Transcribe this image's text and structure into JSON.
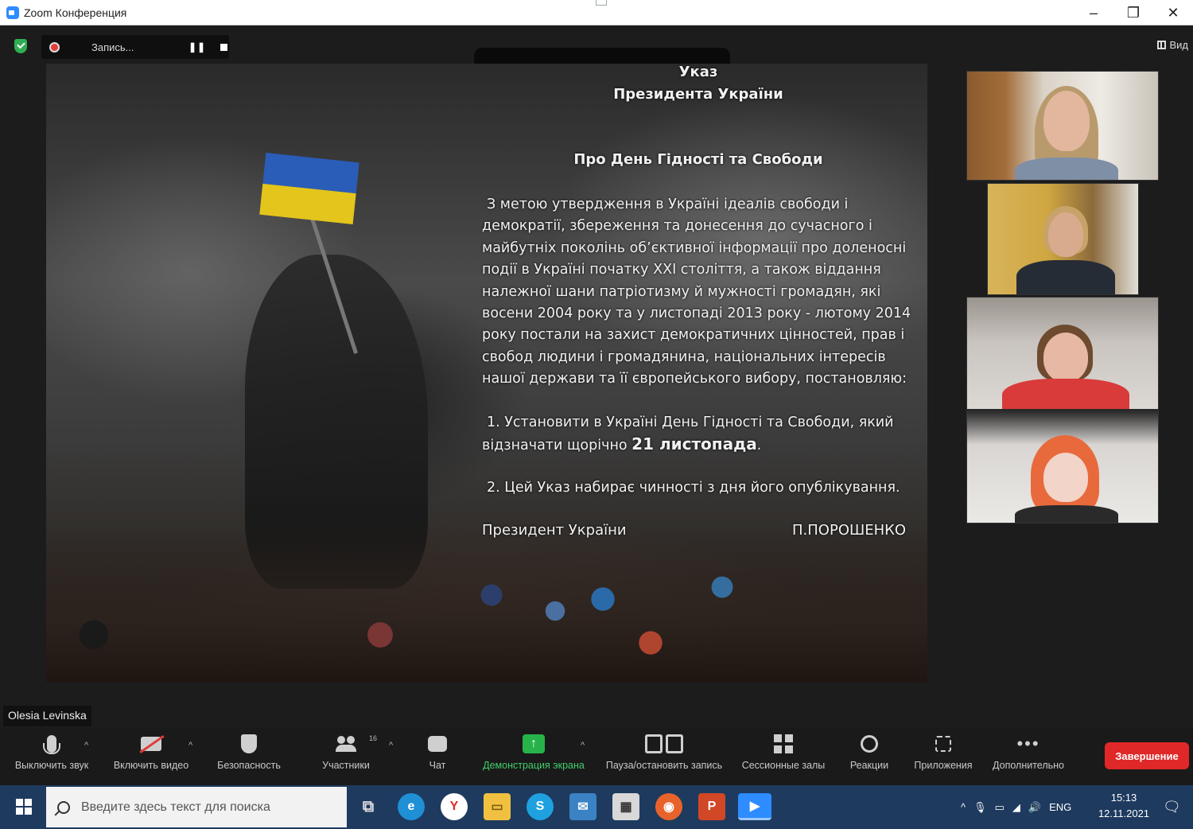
{
  "window": {
    "title": "Zoom Конференция",
    "controls": [
      "–",
      "❐",
      "✕"
    ]
  },
  "recording": {
    "label": "Запись..."
  },
  "view": {
    "label": "Вид"
  },
  "slide": {
    "heading1": "Указ",
    "heading2": "Президента України",
    "subject": "Про День Гідності та Свободи",
    "paragraph": "З метою утвердження в Україні ідеалів свободи і демократії, збереження та донесення до сучасного і майбутніх поколінь об’єктивної інформації про доленосні події в Україні початку XXI століття, а також віддання належної шани патріотизму й мужності громадян, які восени 2004 року та у листопаді 2013 року - лютому 2014 року постали на захист демократичних цінностей, прав і свобод людини і громадянина, національних інтересів нашої держави та її європейського вибору, постановляю:",
    "item1_text": "1. Установити в Україні День Гідності та Свободи, який відзначати щорічно ",
    "item1_date": "21 листопада",
    "item1_end": ".",
    "item2": "2. Цей Указ набирає чинності з дня його опублікування.",
    "signature_left": "Президент  України",
    "signature_right": "П.ПОРОШЕНКО"
  },
  "active_speaker": "Olesia Levinska",
  "toolbar": {
    "mute": "Выключить звук",
    "video": "Включить видео",
    "security": "Безопасность",
    "participants": "Участники",
    "participants_count": "16",
    "chat": "Чат",
    "share": "Демонстрация экрана",
    "pause_record": "Пауза/остановить запись",
    "rooms": "Сессионные залы",
    "reactions": "Реакции",
    "apps": "Приложения",
    "more": "Дополнительно",
    "end": "Завершение"
  },
  "taskbar": {
    "search_placeholder": "Введите здесь текст для поиска",
    "lang": "ENG",
    "time": "15:13",
    "date": "12.11.2021"
  },
  "colors": {
    "share_green": "#27b34a",
    "end_red": "#e02828",
    "taskbar": "#1e3a5f"
  }
}
